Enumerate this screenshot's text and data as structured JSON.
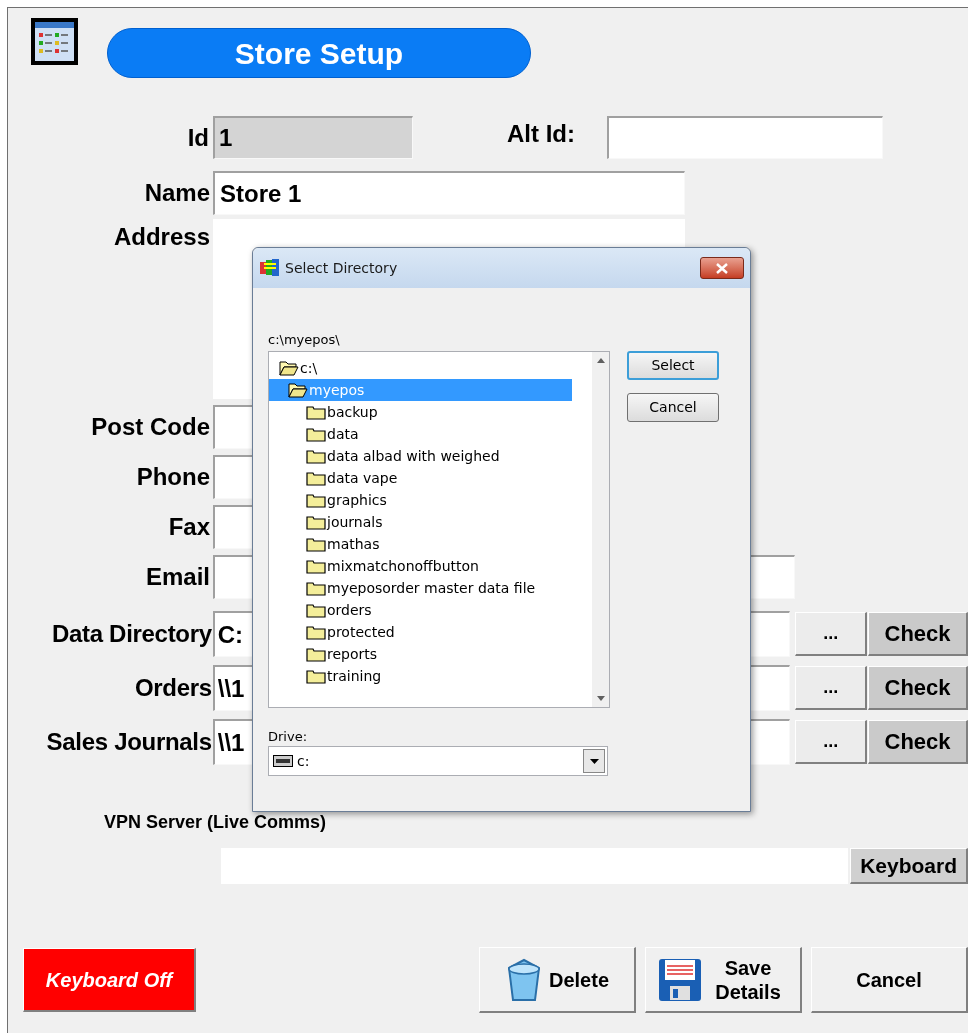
{
  "header": {
    "title": "Store Setup"
  },
  "id_row": {
    "label": "Id",
    "value": "1",
    "disabled": true,
    "alt_label": "Alt Id:"
  },
  "fields": [
    {
      "kind": "text",
      "label": "Name",
      "value": "Store 1"
    },
    {
      "kind": "multiline",
      "label": "Address"
    },
    {
      "kind": "text",
      "label": "Post Code"
    },
    {
      "kind": "text",
      "label": "Phone"
    },
    {
      "kind": "text",
      "label": "Fax"
    },
    {
      "kind": "email",
      "label": "Email"
    },
    {
      "kind": "path",
      "label": "Data Directory",
      "value": "C:",
      "browse": "...",
      "check": "Check"
    },
    {
      "kind": "path",
      "label": "Orders",
      "value": "\\\\1",
      "browse": "...",
      "check": "Check"
    },
    {
      "kind": "path",
      "label": "Sales Journals",
      "value": "\\\\1",
      "browse": "...",
      "check": "Check"
    }
  ],
  "vpn": {
    "label": "VPN Server (Live Comms)",
    "button": "Keyboard"
  },
  "footer": {
    "keyboard_toggle": "Keyboard Off",
    "buttons": [
      {
        "kind": "delete",
        "label": "Delete"
      },
      {
        "kind": "save",
        "label": "Save Details"
      },
      {
        "kind": "cancel",
        "label": "Cancel"
      }
    ]
  },
  "dialog": {
    "title": "Select Directory",
    "path": "c:\\myepos\\",
    "tree": [
      {
        "label": "c:\\",
        "selected": false,
        "expanded": true,
        "children": [
          {
            "label": "myepos",
            "selected": true,
            "expanded": true,
            "children": [
              {
                "label": "backup",
                "selected": false,
                "expanded": false
              },
              {
                "label": "data",
                "selected": false,
                "expanded": false
              },
              {
                "label": "data albad with weighed",
                "selected": false,
                "expanded": false
              },
              {
                "label": "data vape",
                "selected": false,
                "expanded": false
              },
              {
                "label": "graphics",
                "selected": false,
                "expanded": false
              },
              {
                "label": "journals",
                "selected": false,
                "expanded": false
              },
              {
                "label": "mathas",
                "selected": false,
                "expanded": false
              },
              {
                "label": "mixmatchonoffbutton",
                "selected": false,
                "expanded": false
              },
              {
                "label": "myeposorder master data file",
                "selected": false,
                "expanded": false
              },
              {
                "label": "orders",
                "selected": false,
                "expanded": false
              },
              {
                "label": "protected",
                "selected": false,
                "expanded": false
              },
              {
                "label": "reports",
                "selected": false,
                "expanded": false
              },
              {
                "label": "training",
                "selected": false,
                "expanded": false
              }
            ]
          }
        ]
      }
    ],
    "buttons": [
      {
        "label": "Select",
        "default": true
      },
      {
        "label": "Cancel",
        "default": false
      }
    ],
    "drive_label": "Drive:",
    "drive": "c:"
  }
}
